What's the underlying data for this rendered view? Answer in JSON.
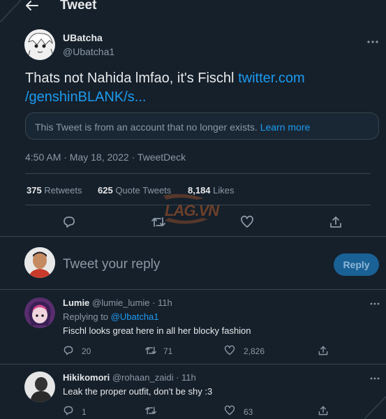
{
  "header": {
    "title": "Tweet"
  },
  "tweet": {
    "author_name": "UBatcha",
    "author_handle": "@Ubatcha1",
    "text": "Thats not Nahida lmfao, it's Fischl ",
    "link_line1": "twitter.com",
    "link_line2": "/genshinBLANK/s...",
    "notice_text": "This Tweet is from an account that no longer exists. ",
    "notice_link": "Learn more",
    "meta": "4:50 AM · May 18, 2022 · TweetDeck",
    "stats": {
      "retweets_count": "375",
      "retweets_label": " Retweets",
      "quotes_count": "625",
      "quotes_label": " Quote Tweets",
      "likes_count": "8,184",
      "likes_label": " Likes"
    }
  },
  "reply_box": {
    "placeholder": "Tweet your reply",
    "button": "Reply"
  },
  "replies": [
    {
      "name": "Lumie",
      "handle": "@lumie_lumie",
      "time": "· 11h",
      "replying_prefix": "Replying to ",
      "replying_to": "@Ubatcha1",
      "text": "Fischl looks great here in all her blocky fashion",
      "reply_count": "20",
      "retweet_count": "71",
      "like_count": "2,826"
    },
    {
      "name": "Hikikomori",
      "handle": "@rohaan_zaidi",
      "time": "· 11h",
      "text": "Leak the proper outfit, don't be shy :3",
      "reply_count": "1",
      "retweet_count": "",
      "like_count": "63"
    }
  ],
  "watermark": {
    "text": "LAG.VN"
  },
  "colors": {
    "background": "#15202b",
    "accent": "#1d9bf0",
    "muted": "#8b98a5",
    "border": "#38444d"
  },
  "icons": [
    "back-arrow-icon",
    "more-icon",
    "reply-icon",
    "retweet-icon",
    "like-icon",
    "share-icon"
  ]
}
